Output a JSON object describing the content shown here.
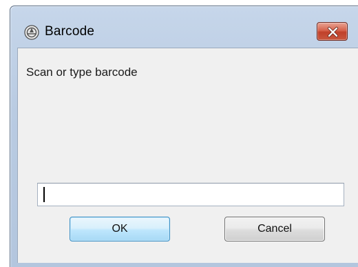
{
  "window": {
    "title": "Barcode",
    "app_icon": "barcode-app-icon",
    "close_icon": "close-icon"
  },
  "dialog": {
    "prompt": "Scan or type barcode",
    "input_value": "",
    "ok_label": "OK",
    "cancel_label": "Cancel"
  },
  "colors": {
    "close_button": "#c9573f",
    "ok_border": "#3c8fc4",
    "client_background": "#f0f0f0"
  }
}
